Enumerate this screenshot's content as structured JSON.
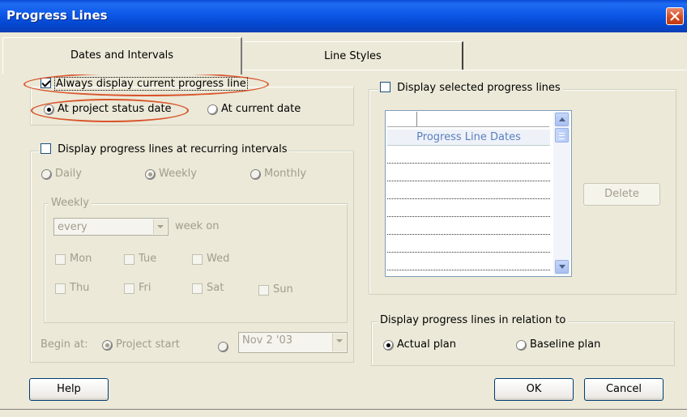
{
  "window": {
    "title": "Progress Lines"
  },
  "tabs": [
    {
      "label": "Dates and Intervals",
      "active": true
    },
    {
      "label": "Line Styles",
      "active": false
    }
  ],
  "current_line": {
    "always_display_label": "Always display current progress line",
    "always_display_checked": true,
    "at_status_date_label": "At project status date",
    "at_status_date_selected": true,
    "at_current_date_label": "At current date",
    "at_current_date_selected": false
  },
  "recurring": {
    "label": "Display progress lines at recurring intervals",
    "checked": false,
    "daily_label": "Daily",
    "weekly_label": "Weekly",
    "monthly_label": "Monthly",
    "selected": "Weekly",
    "weekly_group_title": "Weekly",
    "every_value": "every",
    "week_on_label": "week on",
    "days": [
      "Mon",
      "Tue",
      "Wed",
      "Thu",
      "Fri",
      "Sat",
      "Sun"
    ],
    "begin_at_label": "Begin at:",
    "project_start_label": "Project start",
    "project_start_selected": true,
    "begin_date_value": "Nov 2 '03"
  },
  "selected_lines": {
    "label": "Display selected progress lines",
    "checked": false,
    "column_header": "Progress Line Dates",
    "delete_label": "Delete"
  },
  "relation": {
    "group_title": "Display progress lines in relation to",
    "actual_label": "Actual plan",
    "actual_selected": true,
    "baseline_label": "Baseline plan",
    "baseline_selected": false
  },
  "buttons": {
    "help": "Help",
    "ok": "OK",
    "cancel": "Cancel"
  },
  "colors": {
    "title_bar": "#0a4ad6",
    "dialog_bg": "#ece9d8",
    "highlight": "#d9552c",
    "column_header_text": "#5a7fc0"
  },
  "icons": {
    "close": "close-icon",
    "scroll_up": "arrow-up-icon",
    "scroll_down": "arrow-down-icon",
    "dropdown": "chevron-down-icon"
  }
}
